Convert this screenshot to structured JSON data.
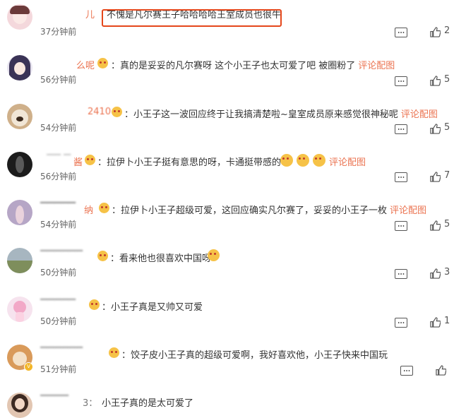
{
  "comments": [
    {
      "user": "儿",
      "text": "不愧是凡尔赛王子哈哈哈哈王室成员也很牛",
      "time": "37分钟前",
      "likes": "2",
      "pic": ""
    },
    {
      "user": "么呢",
      "text": "真的是妥妥的凡尔赛呀 这个小王子也太可爱了吧 被圈粉了",
      "time": "56分钟前",
      "likes": "5",
      "pic": "评论配图"
    },
    {
      "user": "2410",
      "text": "小王子这一波回应终于让我搞清楚啦~皇室成员原来感觉很神秘呢",
      "time": "54分钟前",
      "likes": "5",
      "pic": "评论配图"
    },
    {
      "user": "酱",
      "text": "拉伊卜小王子挺有意思的呀，卡通挺带感的呢",
      "time": "56分钟前",
      "likes": "7",
      "pic": "评论配图"
    },
    {
      "user": "纳",
      "text": "拉伊卜小王子超级可爱，这回应确实凡尔赛了，妥妥的小王子一枚",
      "time": "54分钟前",
      "likes": "5",
      "pic": "评论配图"
    },
    {
      "user": "",
      "text": "看来他也很喜欢中国呀",
      "time": "50分钟前",
      "likes": "3",
      "pic": ""
    },
    {
      "user": "",
      "text": "小王子真是又帅又可爱",
      "time": "50分钟前",
      "likes": "1",
      "pic": ""
    },
    {
      "user": "",
      "text": "饺子皮小王子真的超级可爱啊，我好喜欢他，小王子快来中国玩",
      "time": "51分钟前",
      "likes": "",
      "pic": ""
    },
    {
      "user": "3：",
      "text": "小王子真的是太可爱了",
      "time": "",
      "likes": "",
      "pic": ""
    }
  ],
  "colors": {
    "accent": "#eb7350",
    "highlight": "#e5471b"
  }
}
